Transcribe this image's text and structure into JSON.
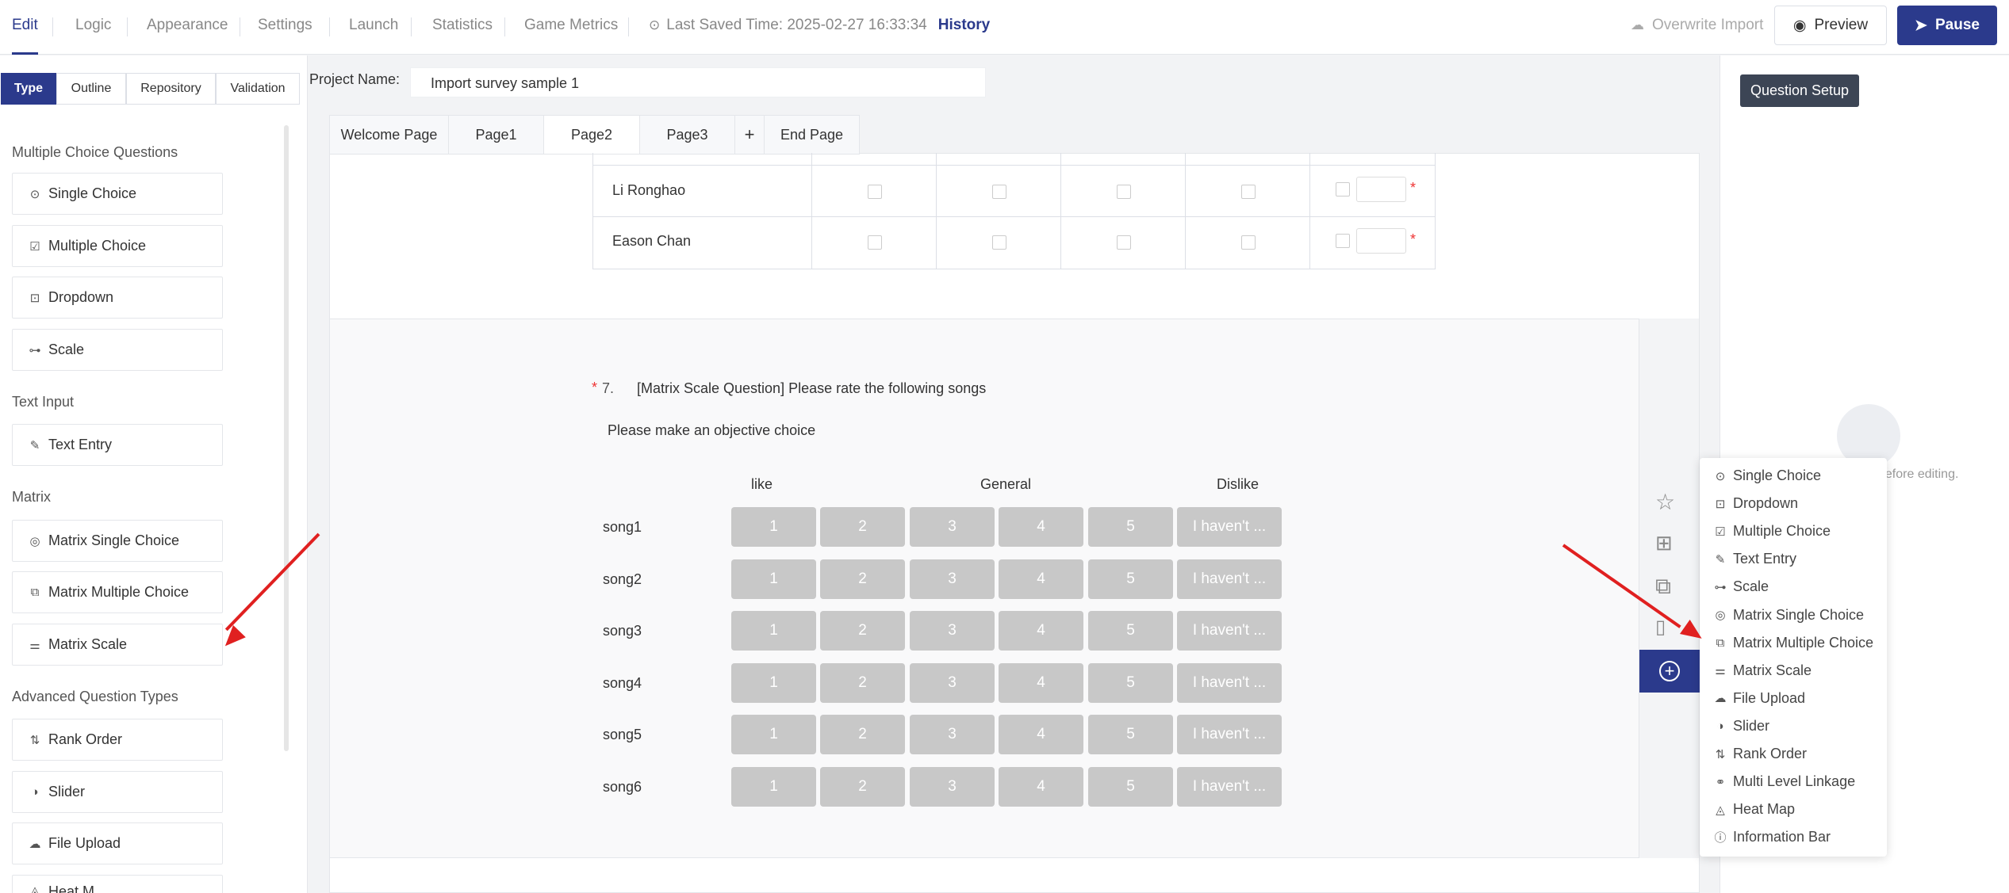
{
  "topbar": {
    "nav": [
      "Edit",
      "Logic",
      "Appearance",
      "Settings",
      "Launch",
      "Statistics",
      "Game Metrics"
    ],
    "last_saved": "Last Saved Time: 2025-02-27 16:33:34",
    "history": "History",
    "overwrite_import": "Overwrite Import",
    "preview": "Preview",
    "pause": "Pause"
  },
  "left": {
    "tabs": [
      "Type",
      "Outline",
      "Repository",
      "Validation"
    ],
    "sections": {
      "multiple": "Multiple Choice Questions",
      "text": "Text Input",
      "matrix": "Matrix",
      "advanced": "Advanced Question Types"
    },
    "items": {
      "single_choice": "Single Choice",
      "multiple_choice": "Multiple Choice",
      "dropdown": "Dropdown",
      "scale": "Scale",
      "text_entry": "Text Entry",
      "matrix_single": "Matrix Single Choice",
      "matrix_multiple": "Matrix Multiple Choice",
      "matrix_scale": "Matrix Scale",
      "rank_order": "Rank Order",
      "slider": "Slider",
      "file_upload": "File Upload",
      "heat_map_partial": "Heat M"
    }
  },
  "project": {
    "label": "Project Name:",
    "value": "Import survey sample 1"
  },
  "pages": [
    "Welcome Page",
    "Page1",
    "Page2",
    "Page3",
    "+",
    "End Page"
  ],
  "grid": {
    "rows": [
      "Li Ronghao",
      "Eason Chan"
    ]
  },
  "question": {
    "number": "7.",
    "required_mark": "*",
    "title": "[Matrix Scale Question] Please rate the following songs",
    "description": "Please make an objective choice",
    "headers": {
      "left": "like",
      "middle": "General",
      "right": "Dislike"
    },
    "rows": [
      "song1",
      "song2",
      "song3",
      "song4",
      "song5",
      "song6"
    ],
    "options": [
      "1",
      "2",
      "3",
      "4",
      "5",
      "I haven't ..."
    ]
  },
  "right": {
    "setup": "Question Setup",
    "placeholder": "before editing."
  },
  "popup": {
    "items": [
      {
        "label": "Single Choice",
        "icon": "radio-icon"
      },
      {
        "label": "Dropdown",
        "icon": "dropdown-icon"
      },
      {
        "label": "Multiple Choice",
        "icon": "checkbox-icon"
      },
      {
        "label": "Text Entry",
        "icon": "pencil-icon"
      },
      {
        "label": "Scale",
        "icon": "scale-icon"
      },
      {
        "label": "Matrix Single Choice",
        "icon": "matrix-single-icon"
      },
      {
        "label": "Matrix Multiple Choice",
        "icon": "matrix-multiple-icon"
      },
      {
        "label": "Matrix Scale",
        "icon": "matrix-scale-icon"
      },
      {
        "label": "File Upload",
        "icon": "upload-icon"
      },
      {
        "label": "Slider",
        "icon": "slider-icon"
      },
      {
        "label": "Rank Order",
        "icon": "rank-icon"
      },
      {
        "label": "Multi Level Linkage",
        "icon": "link-icon"
      },
      {
        "label": "Heat Map",
        "icon": "heatmap-icon"
      },
      {
        "label": "Information Bar",
        "icon": "info-icon"
      }
    ]
  },
  "colors": {
    "accent": "#2b3a8c",
    "option_bg": "#c8c8c8",
    "arrow": "#e02020"
  }
}
